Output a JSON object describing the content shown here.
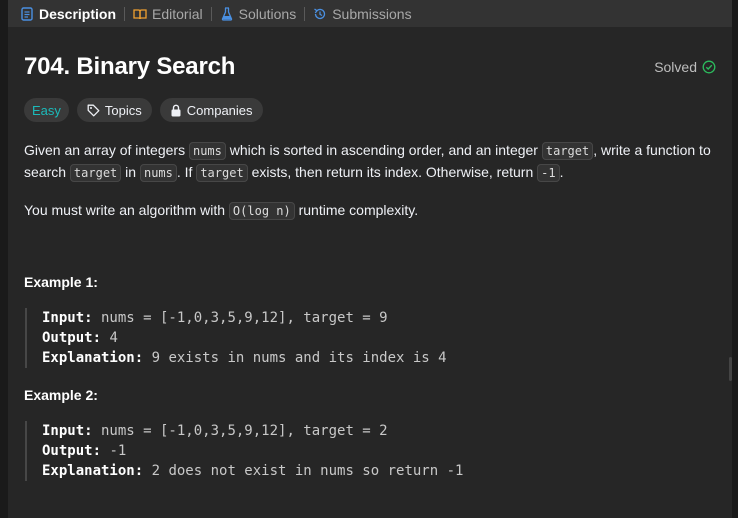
{
  "tabs": [
    {
      "label": "Description",
      "icon": "description-icon",
      "active": true
    },
    {
      "label": "Editorial",
      "icon": "book-icon",
      "active": false
    },
    {
      "label": "Solutions",
      "icon": "flask-icon",
      "active": false
    },
    {
      "label": "Submissions",
      "icon": "history-icon",
      "active": false
    }
  ],
  "problem": {
    "title": "704. Binary Search",
    "status": "Solved",
    "difficulty": "Easy",
    "topics_label": "Topics",
    "companies_label": "Companies"
  },
  "description": {
    "p1": {
      "t1": "Given an array of integers ",
      "c1": "nums",
      "t2": " which is sorted in ascending order, and an integer ",
      "c2": "target",
      "t3": ", write a function to search ",
      "c3": "target",
      "t4": " in ",
      "c4": "nums",
      "t5": ". If ",
      "c5": "target",
      "t6": " exists, then return its index. Otherwise, return ",
      "c6": "-1",
      "t7": "."
    },
    "p2": {
      "t1": "You must write an algorithm with ",
      "c1": "O(log n)",
      "t2": " runtime complexity."
    }
  },
  "examples": [
    {
      "title": "Example 1:",
      "input_label": "Input:",
      "input": " nums = [-1,0,3,5,9,12], target = 9",
      "output_label": "Output:",
      "output": " 4",
      "explanation_label": "Explanation:",
      "explanation": " 9 exists in nums and its index is 4"
    },
    {
      "title": "Example 2:",
      "input_label": "Input:",
      "input": " nums = [-1,0,3,5,9,12], target = 2",
      "output_label": "Output:",
      "output": " -1",
      "explanation_label": "Explanation:",
      "explanation": " 2 does not exist in nums so return -1"
    }
  ],
  "colors": {
    "easy": "#1cbaba",
    "solved_check": "#2cbb5d",
    "description_icon": "#4a90e2"
  }
}
